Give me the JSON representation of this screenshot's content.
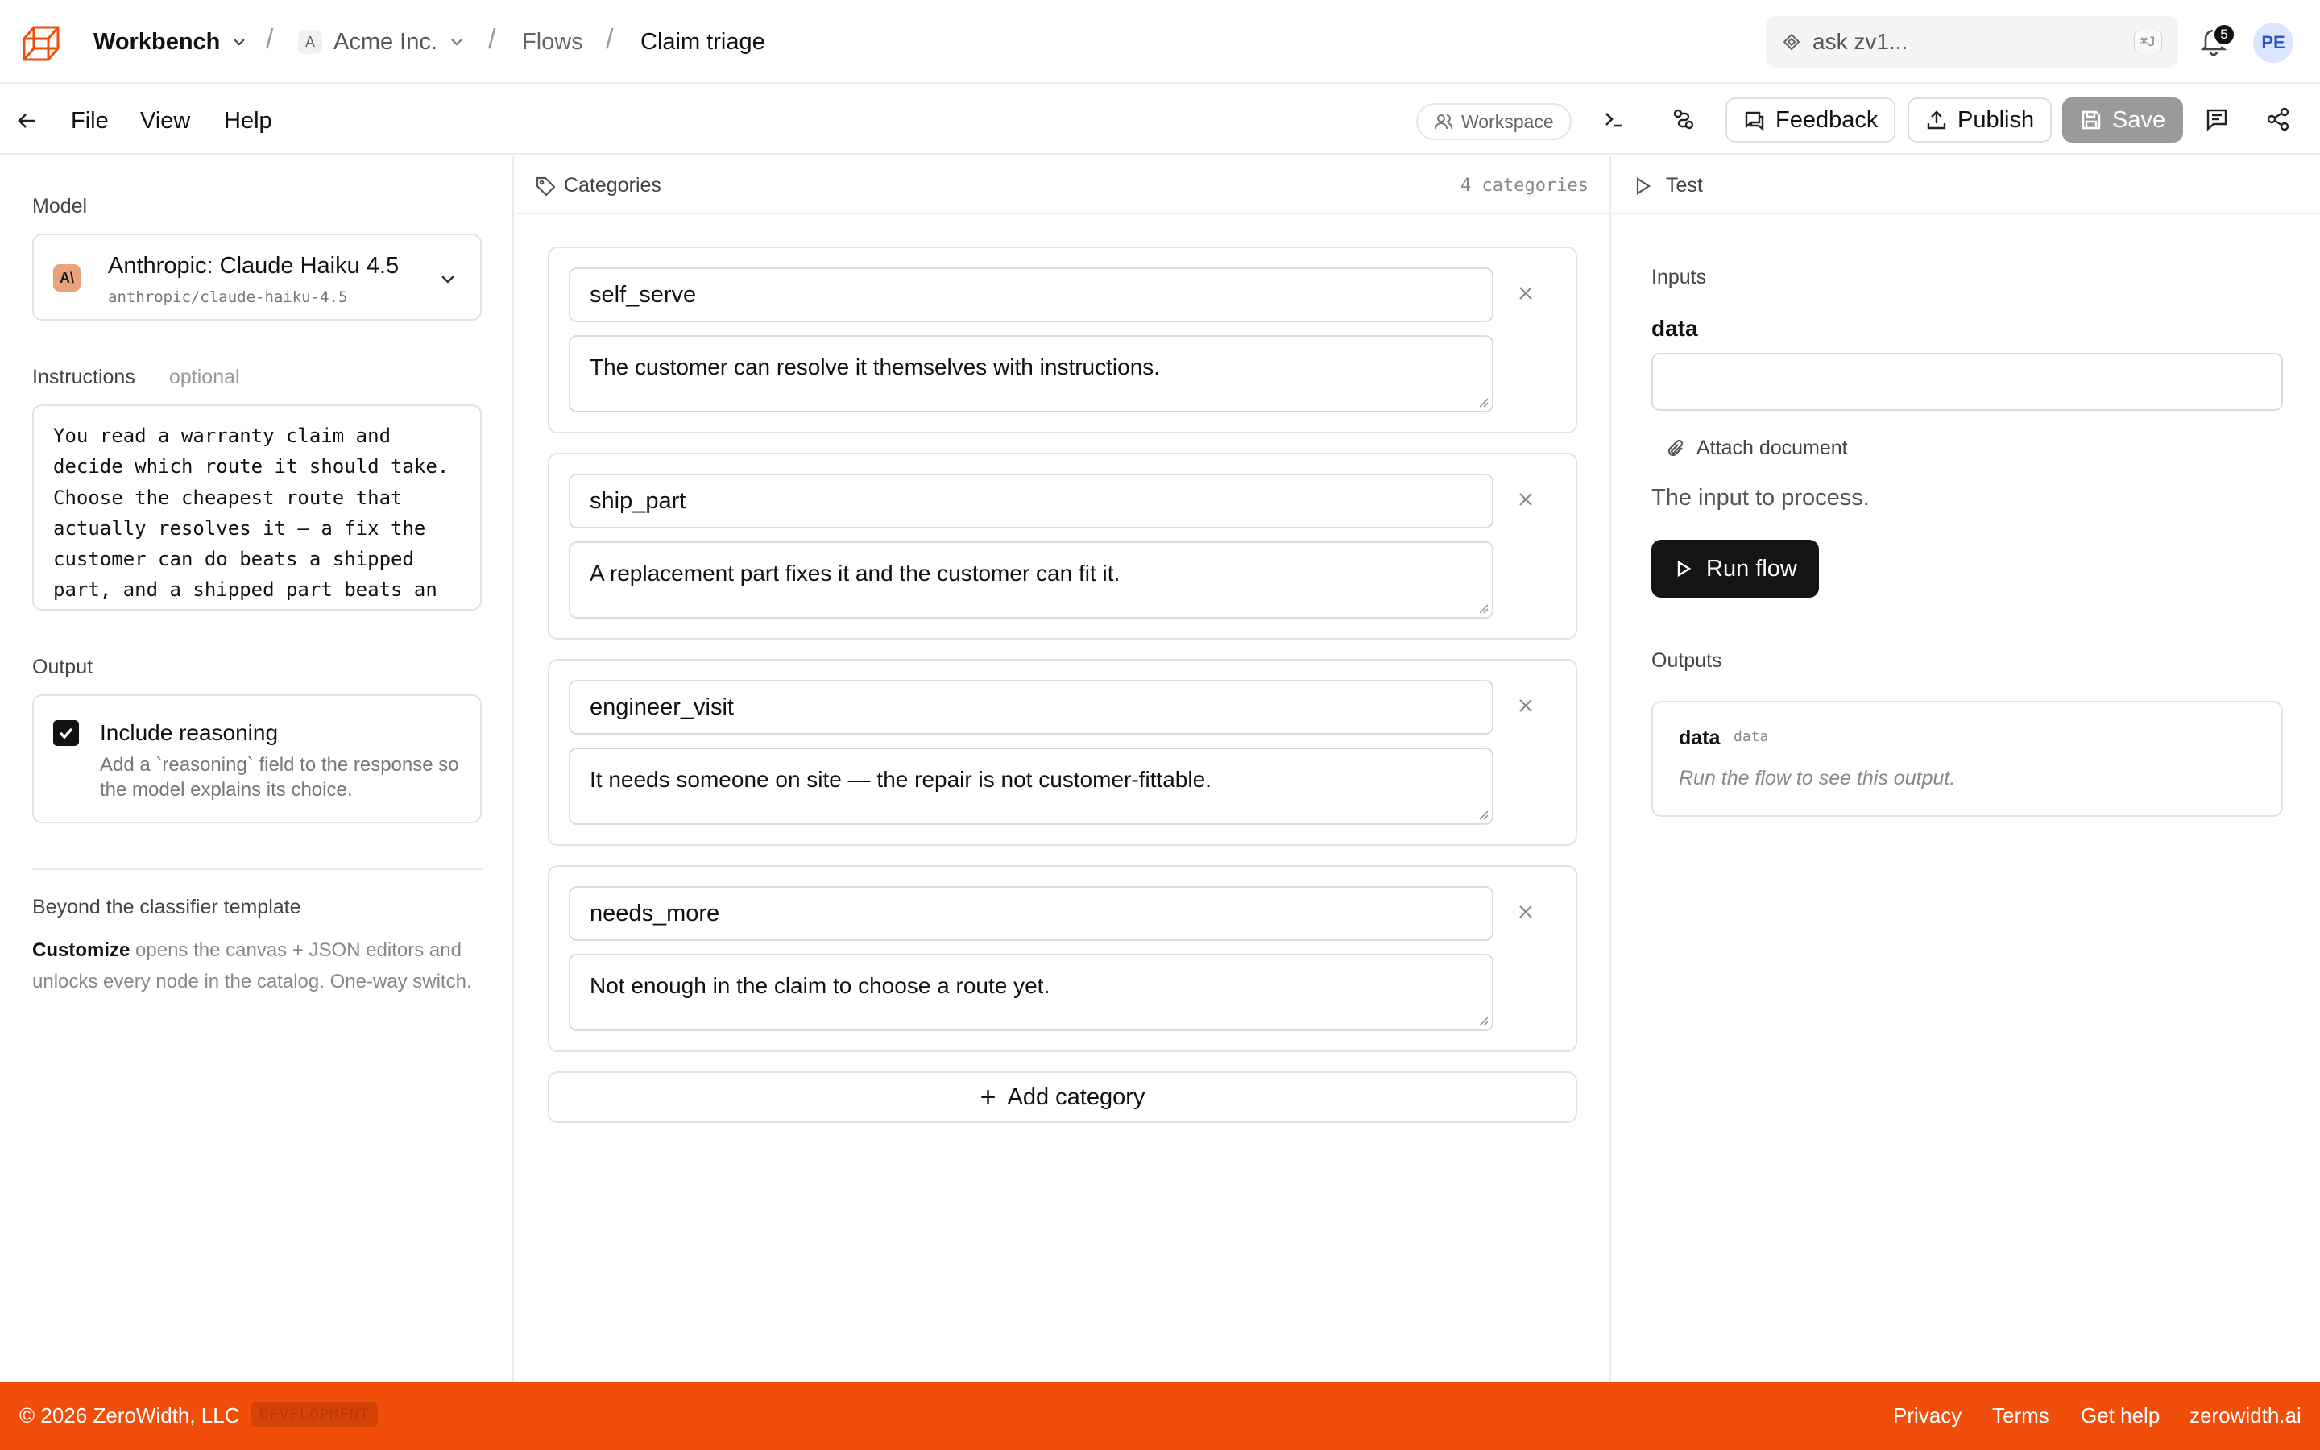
{
  "header": {
    "app": "Workbench",
    "org_initial": "A",
    "org": "Acme Inc.",
    "section": "Flows",
    "page": "Claim triage",
    "search_placeholder": "ask zv1...",
    "search_shortcut": "⌘J",
    "notifications_count": "5",
    "user_initials": "PE"
  },
  "menubar": {
    "file": "File",
    "view": "View",
    "help": "Help",
    "workspace": "Workspace",
    "feedback": "Feedback",
    "publish": "Publish",
    "save": "Save"
  },
  "left": {
    "model_label": "Model",
    "model_name": "Anthropic: Claude Haiku 4.5",
    "model_id": "anthropic/claude-haiku-4.5",
    "instructions_label": "Instructions",
    "instructions_optional": "optional",
    "instructions_text": "You read a warranty claim and\ndecide which route it should take.\nChoose the cheapest route that\nactually resolves it — a fix the\ncustomer can do beats a shipped\npart, and a shipped part beats an",
    "output_label": "Output",
    "include_reasoning_label": "Include reasoning",
    "include_reasoning_checked": true,
    "include_reasoning_desc": "Add a `reasoning` field to the response so the model explains its choice.",
    "beyond_title": "Beyond the classifier template",
    "beyond_bold": "Customize",
    "beyond_desc": " opens the canvas + JSON editors and unlocks every node in the catalog. One-way switch."
  },
  "categories": {
    "title": "Categories",
    "count": "4 categories",
    "items": [
      {
        "name": "self_serve",
        "description": "The customer can resolve it themselves with instructions."
      },
      {
        "name": "ship_part",
        "description": "A replacement part fixes it and the customer can fit it."
      },
      {
        "name": "engineer_visit",
        "description": "It needs someone on site — the repair is not customer-fittable."
      },
      {
        "name": "needs_more",
        "description": "Not enough in the claim to choose a route yet."
      }
    ],
    "add_label": "Add category"
  },
  "test": {
    "title": "Test",
    "inputs_label": "Inputs",
    "field_name": "data",
    "field_value": "",
    "attach_label": "Attach document",
    "field_help": "The input to process.",
    "run_label": "Run flow",
    "outputs_label": "Outputs",
    "output_name": "data",
    "output_type": "data",
    "output_hint": "Run the flow to see this output."
  },
  "footer": {
    "copyright": "© 2026 ZeroWidth, LLC",
    "env": "DEVELOPMENT",
    "privacy": "Privacy",
    "terms": "Terms",
    "help": "Get help",
    "site": "zerowidth.ai"
  },
  "colors": {
    "accent": "#f24e0b",
    "primary_button": "#141414",
    "save_disabled": "#9a9a9a"
  }
}
